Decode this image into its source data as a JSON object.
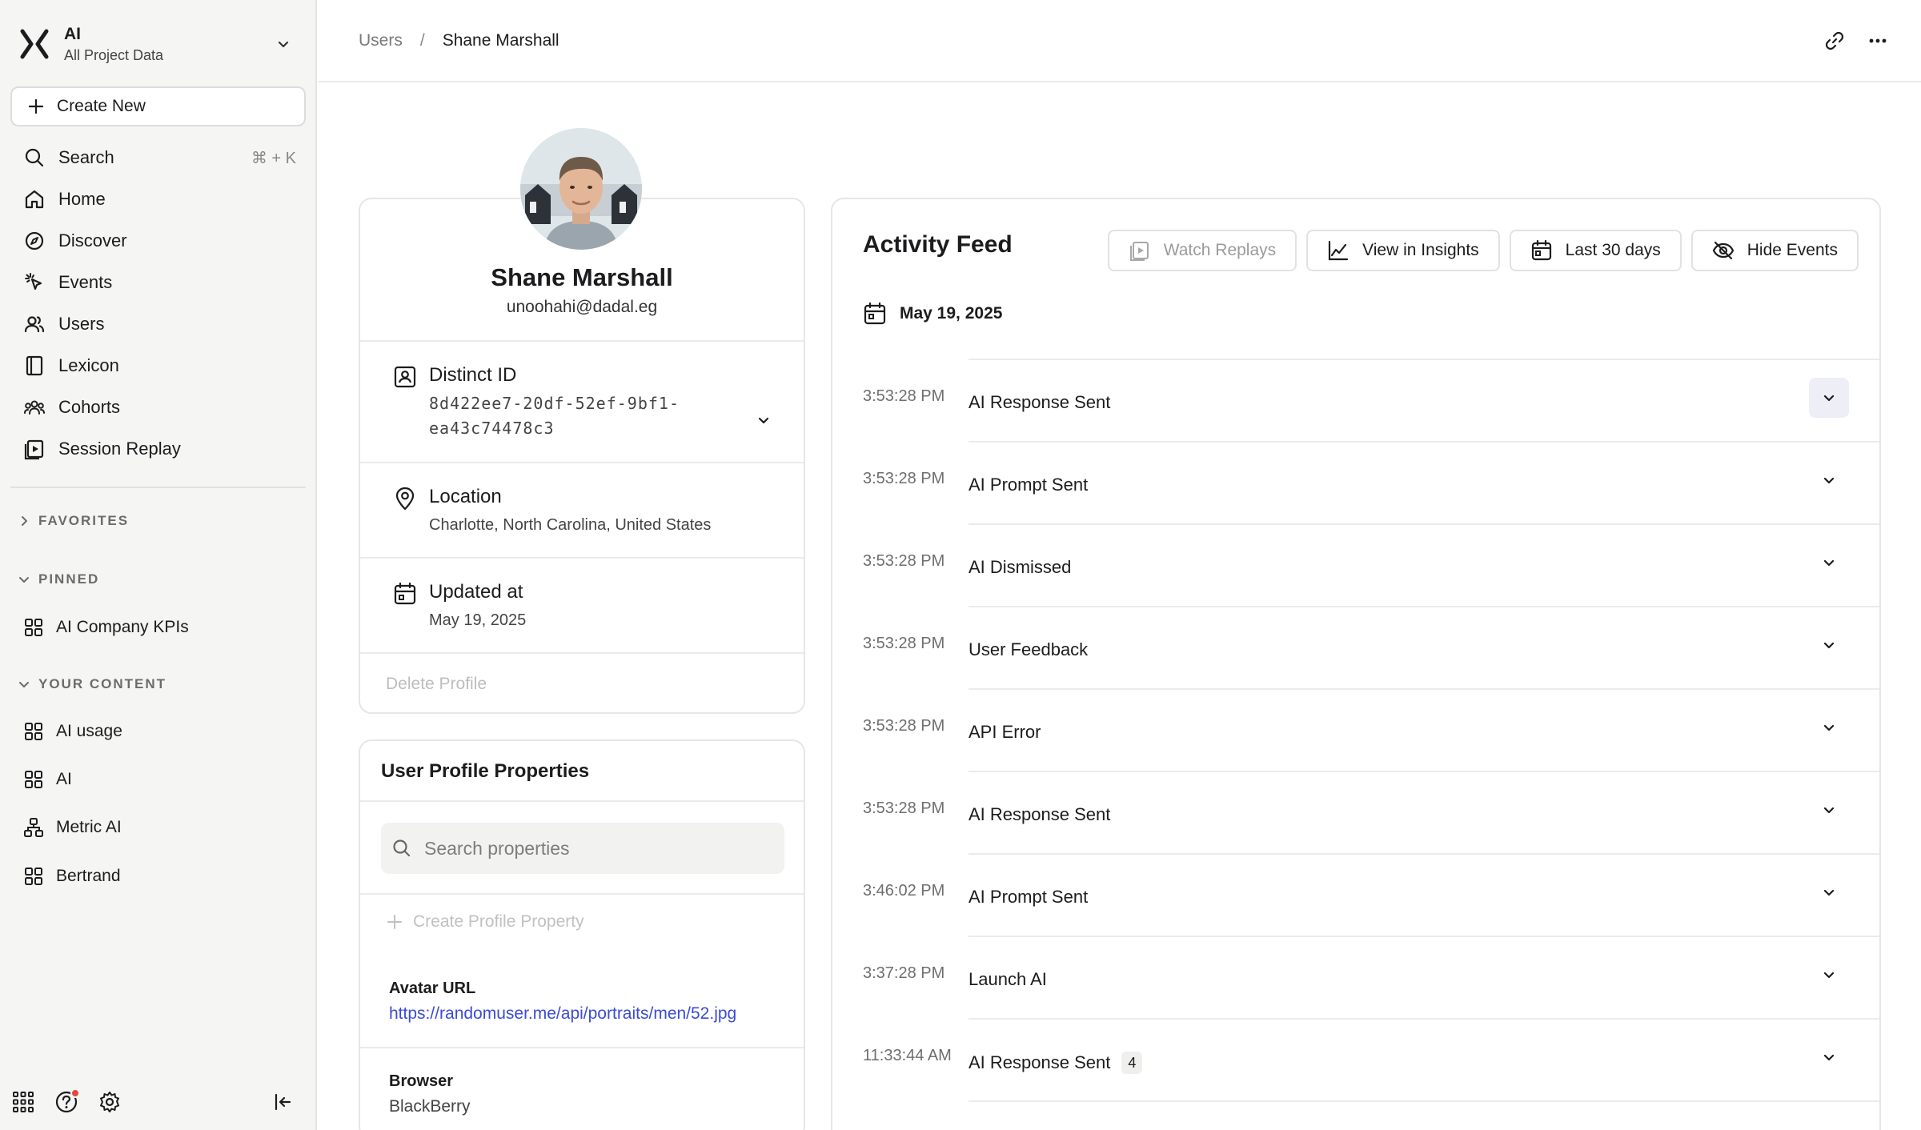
{
  "project": {
    "name": "AI",
    "subtitle": "All Project Data"
  },
  "sidebar": {
    "create_new": "Create New",
    "nav": [
      {
        "label": "Search",
        "icon": "search-icon",
        "shortcut": "⌘ + K"
      },
      {
        "label": "Home",
        "icon": "home-icon"
      },
      {
        "label": "Discover",
        "icon": "compass-icon"
      },
      {
        "label": "Events",
        "icon": "click-icon"
      },
      {
        "label": "Users",
        "icon": "users-icon"
      },
      {
        "label": "Lexicon",
        "icon": "book-icon"
      },
      {
        "label": "Cohorts",
        "icon": "cohorts-icon"
      },
      {
        "label": "Session Replay",
        "icon": "replay-icon"
      }
    ],
    "favorites_label": "FAVORITES",
    "pinned_label": "PINNED",
    "pinned": [
      {
        "label": "AI Company KPIs",
        "icon": "board-icon"
      }
    ],
    "your_content_label": "YOUR CONTENT",
    "content": [
      {
        "label": "AI usage",
        "icon": "board-icon"
      },
      {
        "label": "AI",
        "icon": "board-icon"
      },
      {
        "label": "Metric AI",
        "icon": "metric-tree-icon"
      },
      {
        "label": "Bertrand",
        "icon": "board-icon"
      }
    ]
  },
  "breadcrumb": {
    "parent": "Users",
    "separator": "/",
    "current": "Shane Marshall"
  },
  "profile": {
    "name": "Shane Marshall",
    "email": "unoohahi@dadal.eg",
    "distinct_id_label": "Distinct ID",
    "distinct_id": "8d422ee7-20df-52ef-9bf1-ea43c74478c3",
    "location_label": "Location",
    "location": "Charlotte, North Carolina, United States",
    "updated_label": "Updated at",
    "updated": "May 19, 2025",
    "delete_label": "Delete Profile"
  },
  "properties": {
    "title": "User Profile Properties",
    "search_placeholder": "Search properties",
    "create_label": "Create Profile Property",
    "items": [
      {
        "key": "Avatar URL",
        "value": "https://randomuser.me/api/portraits/men/52.jpg",
        "link": true
      },
      {
        "key": "Browser",
        "value": "BlackBerry",
        "link": false
      }
    ]
  },
  "feed": {
    "title": "Activity Feed",
    "buttons": {
      "watch_replays": "Watch Replays",
      "view_insights": "View in Insights",
      "date_range": "Last 30 days",
      "hide_events": "Hide Events"
    },
    "date": "May 19, 2025",
    "events": [
      {
        "time": "3:53:28 PM",
        "name": "AI Response Sent",
        "count": "",
        "active": true
      },
      {
        "time": "3:53:28 PM",
        "name": "AI Prompt Sent",
        "count": ""
      },
      {
        "time": "3:53:28 PM",
        "name": "AI Dismissed",
        "count": ""
      },
      {
        "time": "3:53:28 PM",
        "name": "User Feedback",
        "count": ""
      },
      {
        "time": "3:53:28 PM",
        "name": "API Error",
        "count": ""
      },
      {
        "time": "3:53:28 PM",
        "name": "AI Response Sent",
        "count": ""
      },
      {
        "time": "3:46:02 PM",
        "name": "AI Prompt Sent",
        "count": ""
      },
      {
        "time": "3:37:28 PM",
        "name": "Launch AI",
        "count": ""
      },
      {
        "time": "11:33:44 AM",
        "name": "AI Response Sent",
        "count": "4"
      }
    ]
  },
  "colors": {
    "accent": "#3b4bd6",
    "notification": "#e5483b",
    "sidebar_bg": "#f5f5f4"
  }
}
